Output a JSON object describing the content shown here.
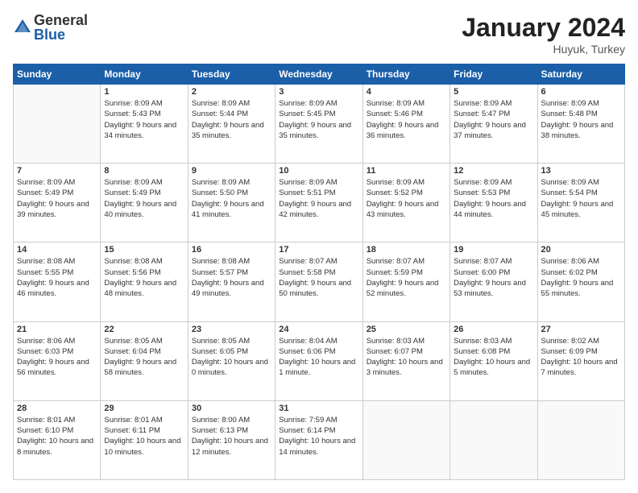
{
  "logo": {
    "general": "General",
    "blue": "Blue"
  },
  "header": {
    "month": "January 2024",
    "location": "Huyuk, Turkey"
  },
  "days_of_week": [
    "Sunday",
    "Monday",
    "Tuesday",
    "Wednesday",
    "Thursday",
    "Friday",
    "Saturday"
  ],
  "weeks": [
    [
      {
        "num": "",
        "sunrise": "",
        "sunset": "",
        "daylight": ""
      },
      {
        "num": "1",
        "sunrise": "Sunrise: 8:09 AM",
        "sunset": "Sunset: 5:43 PM",
        "daylight": "Daylight: 9 hours and 34 minutes."
      },
      {
        "num": "2",
        "sunrise": "Sunrise: 8:09 AM",
        "sunset": "Sunset: 5:44 PM",
        "daylight": "Daylight: 9 hours and 35 minutes."
      },
      {
        "num": "3",
        "sunrise": "Sunrise: 8:09 AM",
        "sunset": "Sunset: 5:45 PM",
        "daylight": "Daylight: 9 hours and 35 minutes."
      },
      {
        "num": "4",
        "sunrise": "Sunrise: 8:09 AM",
        "sunset": "Sunset: 5:46 PM",
        "daylight": "Daylight: 9 hours and 36 minutes."
      },
      {
        "num": "5",
        "sunrise": "Sunrise: 8:09 AM",
        "sunset": "Sunset: 5:47 PM",
        "daylight": "Daylight: 9 hours and 37 minutes."
      },
      {
        "num": "6",
        "sunrise": "Sunrise: 8:09 AM",
        "sunset": "Sunset: 5:48 PM",
        "daylight": "Daylight: 9 hours and 38 minutes."
      }
    ],
    [
      {
        "num": "7",
        "sunrise": "Sunrise: 8:09 AM",
        "sunset": "Sunset: 5:49 PM",
        "daylight": "Daylight: 9 hours and 39 minutes."
      },
      {
        "num": "8",
        "sunrise": "Sunrise: 8:09 AM",
        "sunset": "Sunset: 5:49 PM",
        "daylight": "Daylight: 9 hours and 40 minutes."
      },
      {
        "num": "9",
        "sunrise": "Sunrise: 8:09 AM",
        "sunset": "Sunset: 5:50 PM",
        "daylight": "Daylight: 9 hours and 41 minutes."
      },
      {
        "num": "10",
        "sunrise": "Sunrise: 8:09 AM",
        "sunset": "Sunset: 5:51 PM",
        "daylight": "Daylight: 9 hours and 42 minutes."
      },
      {
        "num": "11",
        "sunrise": "Sunrise: 8:09 AM",
        "sunset": "Sunset: 5:52 PM",
        "daylight": "Daylight: 9 hours and 43 minutes."
      },
      {
        "num": "12",
        "sunrise": "Sunrise: 8:09 AM",
        "sunset": "Sunset: 5:53 PM",
        "daylight": "Daylight: 9 hours and 44 minutes."
      },
      {
        "num": "13",
        "sunrise": "Sunrise: 8:09 AM",
        "sunset": "Sunset: 5:54 PM",
        "daylight": "Daylight: 9 hours and 45 minutes."
      }
    ],
    [
      {
        "num": "14",
        "sunrise": "Sunrise: 8:08 AM",
        "sunset": "Sunset: 5:55 PM",
        "daylight": "Daylight: 9 hours and 46 minutes."
      },
      {
        "num": "15",
        "sunrise": "Sunrise: 8:08 AM",
        "sunset": "Sunset: 5:56 PM",
        "daylight": "Daylight: 9 hours and 48 minutes."
      },
      {
        "num": "16",
        "sunrise": "Sunrise: 8:08 AM",
        "sunset": "Sunset: 5:57 PM",
        "daylight": "Daylight: 9 hours and 49 minutes."
      },
      {
        "num": "17",
        "sunrise": "Sunrise: 8:07 AM",
        "sunset": "Sunset: 5:58 PM",
        "daylight": "Daylight: 9 hours and 50 minutes."
      },
      {
        "num": "18",
        "sunrise": "Sunrise: 8:07 AM",
        "sunset": "Sunset: 5:59 PM",
        "daylight": "Daylight: 9 hours and 52 minutes."
      },
      {
        "num": "19",
        "sunrise": "Sunrise: 8:07 AM",
        "sunset": "Sunset: 6:00 PM",
        "daylight": "Daylight: 9 hours and 53 minutes."
      },
      {
        "num": "20",
        "sunrise": "Sunrise: 8:06 AM",
        "sunset": "Sunset: 6:02 PM",
        "daylight": "Daylight: 9 hours and 55 minutes."
      }
    ],
    [
      {
        "num": "21",
        "sunrise": "Sunrise: 8:06 AM",
        "sunset": "Sunset: 6:03 PM",
        "daylight": "Daylight: 9 hours and 56 minutes."
      },
      {
        "num": "22",
        "sunrise": "Sunrise: 8:05 AM",
        "sunset": "Sunset: 6:04 PM",
        "daylight": "Daylight: 9 hours and 58 minutes."
      },
      {
        "num": "23",
        "sunrise": "Sunrise: 8:05 AM",
        "sunset": "Sunset: 6:05 PM",
        "daylight": "Daylight: 10 hours and 0 minutes."
      },
      {
        "num": "24",
        "sunrise": "Sunrise: 8:04 AM",
        "sunset": "Sunset: 6:06 PM",
        "daylight": "Daylight: 10 hours and 1 minute."
      },
      {
        "num": "25",
        "sunrise": "Sunrise: 8:03 AM",
        "sunset": "Sunset: 6:07 PM",
        "daylight": "Daylight: 10 hours and 3 minutes."
      },
      {
        "num": "26",
        "sunrise": "Sunrise: 8:03 AM",
        "sunset": "Sunset: 6:08 PM",
        "daylight": "Daylight: 10 hours and 5 minutes."
      },
      {
        "num": "27",
        "sunrise": "Sunrise: 8:02 AM",
        "sunset": "Sunset: 6:09 PM",
        "daylight": "Daylight: 10 hours and 7 minutes."
      }
    ],
    [
      {
        "num": "28",
        "sunrise": "Sunrise: 8:01 AM",
        "sunset": "Sunset: 6:10 PM",
        "daylight": "Daylight: 10 hours and 8 minutes."
      },
      {
        "num": "29",
        "sunrise": "Sunrise: 8:01 AM",
        "sunset": "Sunset: 6:11 PM",
        "daylight": "Daylight: 10 hours and 10 minutes."
      },
      {
        "num": "30",
        "sunrise": "Sunrise: 8:00 AM",
        "sunset": "Sunset: 6:13 PM",
        "daylight": "Daylight: 10 hours and 12 minutes."
      },
      {
        "num": "31",
        "sunrise": "Sunrise: 7:59 AM",
        "sunset": "Sunset: 6:14 PM",
        "daylight": "Daylight: 10 hours and 14 minutes."
      },
      {
        "num": "",
        "sunrise": "",
        "sunset": "",
        "daylight": ""
      },
      {
        "num": "",
        "sunrise": "",
        "sunset": "",
        "daylight": ""
      },
      {
        "num": "",
        "sunrise": "",
        "sunset": "",
        "daylight": ""
      }
    ]
  ]
}
